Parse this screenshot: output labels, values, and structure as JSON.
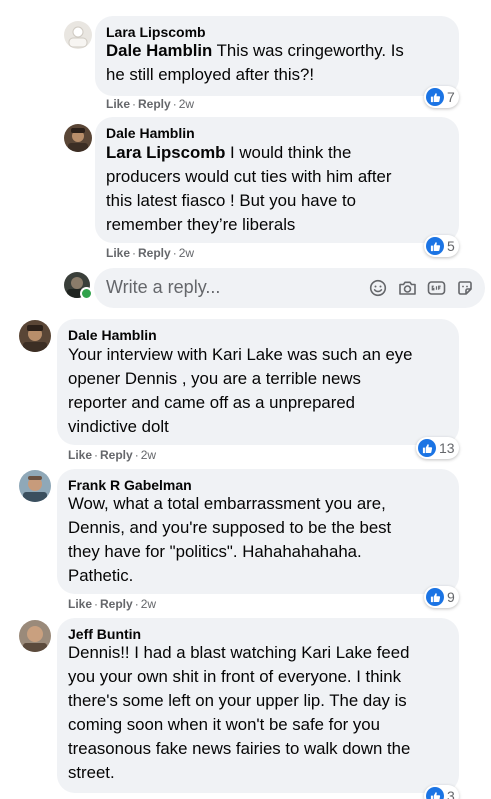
{
  "comments": [
    {
      "author": "Lara Lipscomb",
      "mention": "Dale Hamblin",
      "text": "This was cringeworthy. Is\nhe still employed after this?!",
      "like": "Like",
      "reply": "Reply",
      "time": "2w",
      "reactions": "7"
    },
    {
      "author": "Dale Hamblin",
      "mention": "Lara Lipscomb",
      "text": "I would think the\nproducers would cut ties with him after\nthis latest fiasco ! But you have to\nremember they’re liberals",
      "like": "Like",
      "reply": "Reply",
      "time": "2w",
      "reactions": "5"
    },
    {
      "author": "Dale Hamblin",
      "text": "Your interview with Kari Lake was such an eye\nopener Dennis , you are a terrible news\nreporter and came off as a unprepared\nvindictive dolt",
      "like": "Like",
      "reply": "Reply",
      "time": "2w",
      "reactions": "13"
    },
    {
      "author": "Frank R Gabelman",
      "text": "Wow, what a total embarrassment you are,\nDennis, and you're supposed to be the best\nthey have for \"politics\". Hahahahahaha.\nPathetic.",
      "like": "Like",
      "reply": "Reply",
      "time": "2w",
      "reactions": "9"
    },
    {
      "author": "Jeff Buntin",
      "text": "Dennis!! I had a blast watching Kari Lake feed\nyou your own shit in front of everyone. I think\nthere's some left on your upper lip. The day is\ncoming soon when it won't be safe for you\ntreasonous fake news fairies to walk down the\nstreet.",
      "reactions": "3"
    }
  ],
  "reply_box": {
    "placeholder": "Write a reply..."
  },
  "colors": {
    "bubble": "#f0f2f5",
    "like_blue": "#1b74e4",
    "meta_gray": "#65676b",
    "text": "#050505"
  }
}
